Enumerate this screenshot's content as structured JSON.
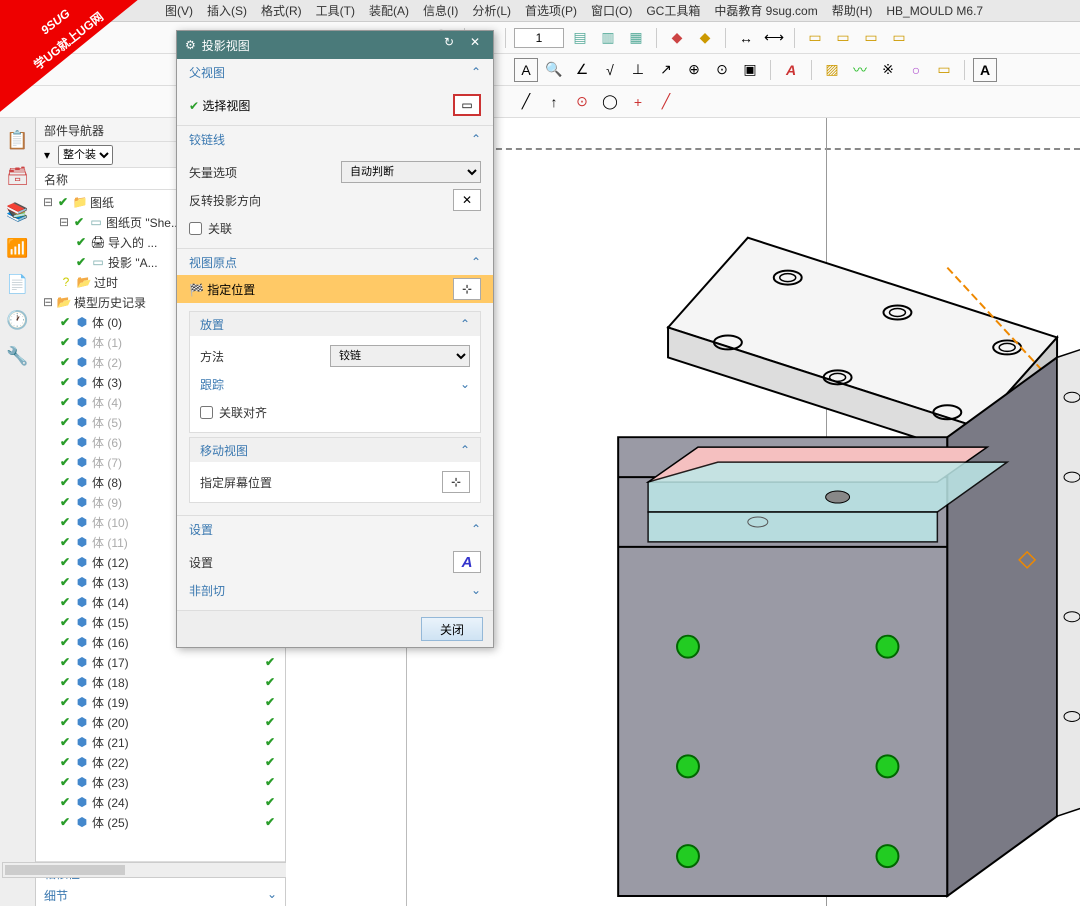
{
  "menu": {
    "items": [
      "图(V)",
      "插入(S)",
      "格式(R)",
      "工具(T)",
      "装配(A)",
      "信息(I)",
      "分析(L)",
      "首选项(P)",
      "窗口(O)",
      "GC工具箱",
      "中磊教育 9sug.com",
      "帮助(H)",
      "HB_MOULD M6.7"
    ]
  },
  "watermark": {
    "line1": "9SUG",
    "line2": "学UG就上UG网"
  },
  "nav": {
    "title": "部件导航器",
    "col": "名称",
    "drawings": "图纸",
    "sheet": "图纸页 \"She...",
    "imported": "导入的 ...",
    "proj": "投影 \"A...",
    "outdated": "过时",
    "history": "模型历史记录",
    "bodies": [
      {
        "label": "体 (0)",
        "gray": false
      },
      {
        "label": "体 (1)",
        "gray": true
      },
      {
        "label": "体 (2)",
        "gray": true
      },
      {
        "label": "体 (3)",
        "gray": false
      },
      {
        "label": "体 (4)",
        "gray": true
      },
      {
        "label": "体 (5)",
        "gray": true
      },
      {
        "label": "体 (6)",
        "gray": true
      },
      {
        "label": "体 (7)",
        "gray": true
      },
      {
        "label": "体 (8)",
        "gray": false
      },
      {
        "label": "体 (9)",
        "gray": true
      },
      {
        "label": "体 (10)",
        "gray": true
      },
      {
        "label": "体 (11)",
        "gray": true
      },
      {
        "label": "体 (12)",
        "gray": false
      },
      {
        "label": "体 (13)",
        "gray": false
      },
      {
        "label": "体 (14)",
        "gray": false
      },
      {
        "label": "体 (15)",
        "gray": false
      },
      {
        "label": "体 (16)",
        "gray": false
      },
      {
        "label": "体 (17)",
        "gray": false
      },
      {
        "label": "体 (18)",
        "gray": false
      },
      {
        "label": "体 (19)",
        "gray": false
      },
      {
        "label": "体 (20)",
        "gray": false
      },
      {
        "label": "体 (21)",
        "gray": false
      },
      {
        "label": "体 (22)",
        "gray": false
      },
      {
        "label": "体 (23)",
        "gray": false
      },
      {
        "label": "体 (24)",
        "gray": false
      },
      {
        "label": "体 (25)",
        "gray": false
      }
    ],
    "dep": "相依性",
    "detail": "细节"
  },
  "filter": {
    "opt": "整个装"
  },
  "dialog": {
    "title": "投影视图",
    "s1": "父视图",
    "s1a": "选择视图",
    "s2": "铰链线",
    "s2a": "矢量选项",
    "s2a_val": "自动判断",
    "s2b": "反转投影方向",
    "s2c": "关联",
    "s3": "视图原点",
    "s3a": "指定位置",
    "s3b": "放置",
    "s3b1": "方法",
    "s3b1_val": "铰链",
    "s3b2": "跟踪",
    "s3b3": "关联对齐",
    "s3c": "移动视图",
    "s3c1": "指定屏幕位置",
    "s4": "设置",
    "s4a": "设置",
    "s4b": "非剖切",
    "close": "关闭"
  },
  "toolbar": {
    "scale": "1"
  }
}
